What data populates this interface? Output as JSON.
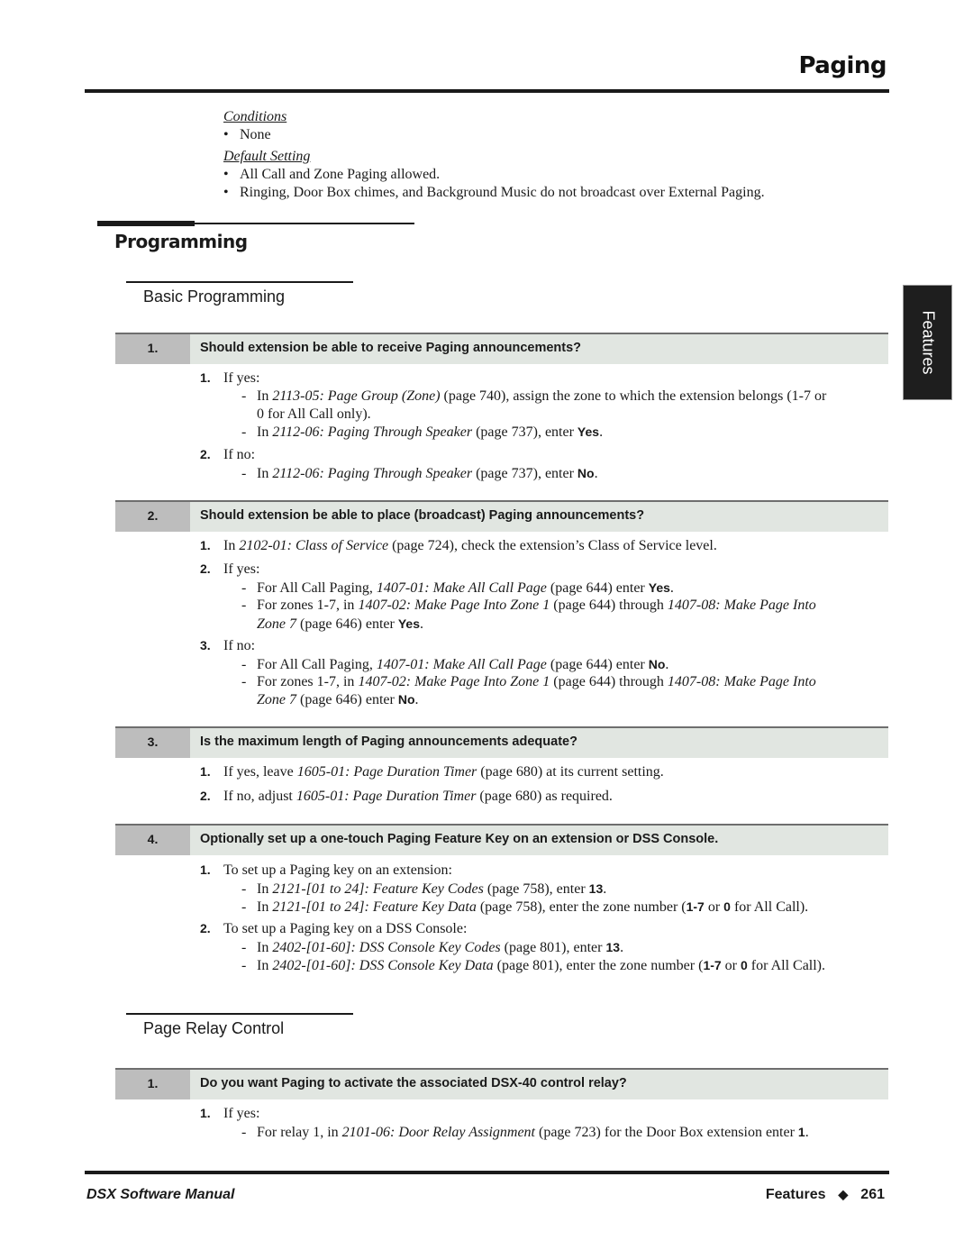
{
  "header": {
    "title": "Paging"
  },
  "side_tab": {
    "label": "Features"
  },
  "conditions": {
    "heading": "Conditions",
    "items": [
      "None"
    ]
  },
  "default_setting": {
    "heading": "Default Setting",
    "items": [
      "All Call and Zone Paging allowed.",
      "Ringing, Door Box chimes, and Background Music do not broadcast over External Paging."
    ]
  },
  "section": {
    "title": "Programming"
  },
  "basic": {
    "title": "Basic Programming",
    "q1": {
      "num": "1.",
      "text": "Should extension be able to receive Paging announcements?",
      "s1": {
        "n": "1.",
        "t": "If yes:"
      },
      "d1a": {
        "pre": "In ",
        "ref": "2113-05: Page Group (Zone)",
        "post": " (page 740), assign the zone to which the extension belongs (1-7 or"
      },
      "d1a_cont": "0 for All Call only).",
      "d1b": {
        "pre": "In ",
        "ref": "2112-06: Paging Through Speaker",
        "post": " (page 737), enter ",
        "val": "Yes",
        "end": "."
      },
      "s2": {
        "n": "2.",
        "t": "If no:"
      },
      "d2a": {
        "pre": "In ",
        "ref": "2112-06: Paging Through Speaker",
        "post": " (page 737), enter ",
        "val": "No",
        "end": "."
      }
    },
    "q2": {
      "num": "2.",
      "text": "Should extension be able to place (broadcast) Paging announcements?",
      "s1": {
        "n": "1.",
        "pre": "In ",
        "ref": "2102-01: Class of Service",
        "post": " (page 724), check the extension’s Class of Service level."
      },
      "s2": {
        "n": "2.",
        "t": "If yes:"
      },
      "d2a": {
        "pre": "For All Call Paging, ",
        "ref": "1407-01: Make All Call Page",
        "post": " (page 644) enter ",
        "val": "Yes",
        "end": "."
      },
      "d2b": {
        "pre": "For zones 1-7, in ",
        "ref": "1407-02: Make Page Into Zone 1",
        "mid": " (page 644) through ",
        "ref2": "1407-08: Make Page Into"
      },
      "d2b_cont": {
        "ref": "Zone 7",
        "post": " (page 646) enter ",
        "val": "Yes",
        "end": "."
      },
      "s3": {
        "n": "3.",
        "t": "If no:"
      },
      "d3a": {
        "pre": "For All Call Paging, ",
        "ref": "1407-01: Make All Call Page",
        "post": " (page 644) enter ",
        "val": "No",
        "end": "."
      },
      "d3b": {
        "pre": "For zones 1-7, in ",
        "ref": "1407-02: Make Page Into Zone 1",
        "mid": " (page 644) through ",
        "ref2": "1407-08: Make Page Into"
      },
      "d3b_cont": {
        "ref": "Zone 7",
        "post": " (page 646) enter ",
        "val": "No",
        "end": "."
      }
    },
    "q3": {
      "num": "3.",
      "text": "Is the maximum length of Paging announcements adequate?",
      "s1": {
        "n": "1.",
        "pre": "If yes, leave ",
        "ref": "1605-01: Page Duration Timer",
        "post": " (page 680) at its current setting."
      },
      "s2": {
        "n": "2.",
        "pre": "If no, adjust ",
        "ref": "1605-01: Page Duration Timer",
        "post": " (page 680) as required."
      }
    },
    "q4": {
      "num": "4.",
      "text": "Optionally set up a one-touch Paging Feature Key on an extension or DSS Console.",
      "s1": {
        "n": "1.",
        "t": "To set up a Paging key on an extension:"
      },
      "d1a": {
        "pre": "In ",
        "ref": "2121-[01 to 24]: Feature Key Codes",
        "post": " (page 758), enter ",
        "val": "13",
        "end": "."
      },
      "d1b": {
        "pre": "In ",
        "ref": "2121-[01 to 24]: Feature Key Data",
        "post": " (page 758), enter the zone number (",
        "v1": "1-7",
        "or": " or ",
        "v2": "0",
        "end": " for All Call)."
      },
      "s2": {
        "n": "2.",
        "t": "To set up a Paging key on a DSS Console:"
      },
      "d2a": {
        "pre": "In ",
        "ref": "2402-[01-60]: DSS Console Key Codes",
        "post": " (page 801), enter ",
        "val": "13",
        "end": "."
      },
      "d2b": {
        "pre": "In ",
        "ref": "2402-[01-60]: DSS Console Key Data",
        "post": " (page 801), enter the zone number (",
        "v1": "1-7",
        "or": " or ",
        "v2": "0",
        "end": " for All Call)."
      }
    }
  },
  "relay": {
    "title": "Page Relay Control",
    "q1": {
      "num": "1.",
      "text": "Do you want Paging to activate the associated DSX-40 control relay?",
      "s1": {
        "n": "1.",
        "t": "If yes:"
      },
      "d1a": {
        "pre": "For relay 1, in ",
        "ref": "2101-06: Door Relay Assignment",
        "post": " (page 723) for the Door Box extension enter ",
        "val": "1",
        "end": "."
      }
    }
  },
  "footer": {
    "manual": "DSX Software Manual",
    "chapter": "Features",
    "separator": "◆",
    "page": "261"
  }
}
